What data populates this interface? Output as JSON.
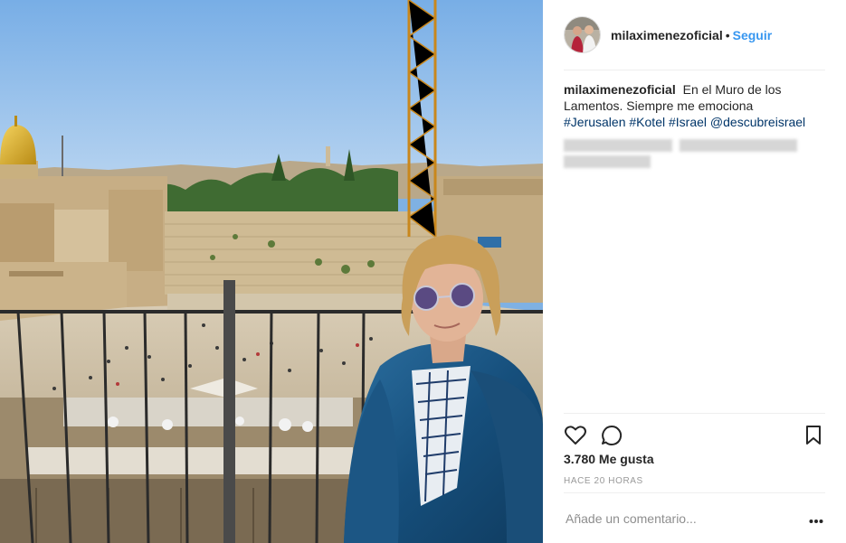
{
  "post": {
    "username": "milaximenezoficial",
    "follow_label": "Seguir",
    "separator": "•",
    "caption_text": "En el Muro de los Lamentos. Siempre me emociona",
    "hashtags": [
      "#Jerusalen",
      "#Kotel",
      "#Israel",
      "@descubreisrael"
    ],
    "likes": "3.780 Me gusta",
    "timestamp": "HACE 20 HORAS",
    "comment_placeholder": "Añade un comentario...",
    "icons": {
      "like": "heart-icon",
      "comment": "comment-icon",
      "save": "bookmark-icon",
      "more": "more-options-icon"
    }
  },
  "colors": {
    "link_blue": "#3897f0",
    "hashtag_blue": "#003569",
    "muted": "#999999",
    "divider": "#efefef"
  }
}
